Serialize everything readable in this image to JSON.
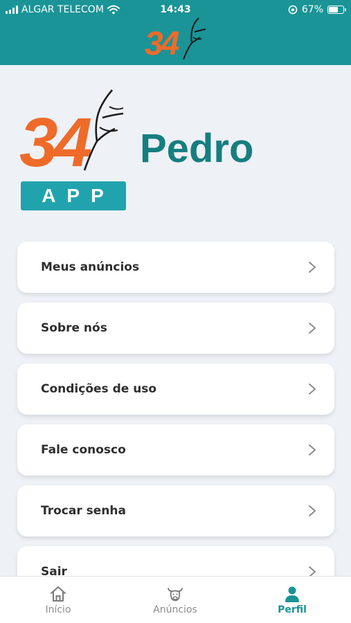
{
  "status_bar": {
    "carrier": "ALGAR TELECOM",
    "time": "14:43",
    "battery": "67%",
    "battery_level": 0.67
  },
  "header": {
    "logo_text": "34"
  },
  "brand": {
    "logo_text": "34",
    "name": "Pedro",
    "badge": "APP"
  },
  "menu": {
    "items": [
      {
        "label": "Meus anúncios"
      },
      {
        "label": "Sobre nós"
      },
      {
        "label": "Condições de uso"
      },
      {
        "label": "Fale conosco"
      },
      {
        "label": "Trocar senha"
      },
      {
        "label": "Sair"
      }
    ]
  },
  "bottom_nav": {
    "items": [
      {
        "label": "Início",
        "icon": "home-icon"
      },
      {
        "label": "Anúncios",
        "icon": "cow-icon"
      },
      {
        "label": "Perfil",
        "icon": "user-icon",
        "active": true
      }
    ]
  },
  "colors": {
    "primary": "#1a9497",
    "brand_orange": "#ee6b2a",
    "brand_teal": "#167e80",
    "badge": "#21a3ad",
    "background": "#eef1f6"
  }
}
